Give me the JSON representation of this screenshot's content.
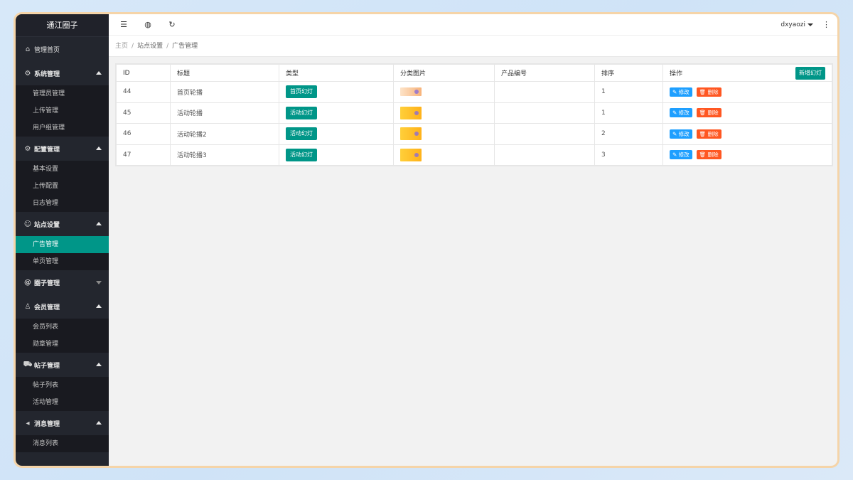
{
  "sidebar": {
    "logo": "通江圈子",
    "home": {
      "label": "管理首页",
      "icon": "home-icon"
    },
    "groups": [
      {
        "title": "系统管理",
        "icon": "gear-icon",
        "expanded": true,
        "items": [
          "管理员管理",
          "上传管理",
          "用户组管理"
        ]
      },
      {
        "title": "配置管理",
        "icon": "gear-icon",
        "expanded": true,
        "items": [
          "基本设置",
          "上传配置",
          "日志管理"
        ]
      },
      {
        "title": "站点设置",
        "icon": "site-icon",
        "expanded": true,
        "items": [
          "广告管理",
          "单页管理"
        ],
        "active_item": "广告管理"
      },
      {
        "title": "圈子管理",
        "icon": "at-icon",
        "expanded": false,
        "items": []
      },
      {
        "title": "会员管理",
        "icon": "user-icon",
        "expanded": true,
        "items": [
          "会员列表",
          "勋章管理"
        ]
      },
      {
        "title": "帖子管理",
        "icon": "cart-icon",
        "expanded": true,
        "items": [
          "帖子列表",
          "活动管理"
        ]
      },
      {
        "title": "消息管理",
        "icon": "speaker-icon",
        "expanded": true,
        "items": [
          "消息列表"
        ]
      }
    ]
  },
  "topbar": {
    "user": "dxyaozi"
  },
  "breadcrumb": {
    "home": "主页",
    "section": "站点设置",
    "current": "广告管理"
  },
  "table": {
    "columns": [
      "ID",
      "标题",
      "类型",
      "分类图片",
      "产品编号",
      "排序",
      "操作"
    ],
    "new_button": "新增幻灯",
    "edit_label": "✎ 修改",
    "delete_label": "🗑 删除",
    "rows": [
      {
        "id": "44",
        "title": "首页轮播",
        "type": "首页幻灯",
        "product": "",
        "sort": "1"
      },
      {
        "id": "45",
        "title": "活动轮播",
        "type": "活动幻灯",
        "product": "",
        "sort": "1"
      },
      {
        "id": "46",
        "title": "活动轮播2",
        "type": "活动幻灯",
        "product": "",
        "sort": "2"
      },
      {
        "id": "47",
        "title": "活动轮播3",
        "type": "活动幻灯",
        "product": "",
        "sort": "3"
      }
    ]
  },
  "colors": {
    "accent": "#009688",
    "edit": "#1e9fff",
    "delete": "#ff5722",
    "sidebar": "#23262e"
  }
}
